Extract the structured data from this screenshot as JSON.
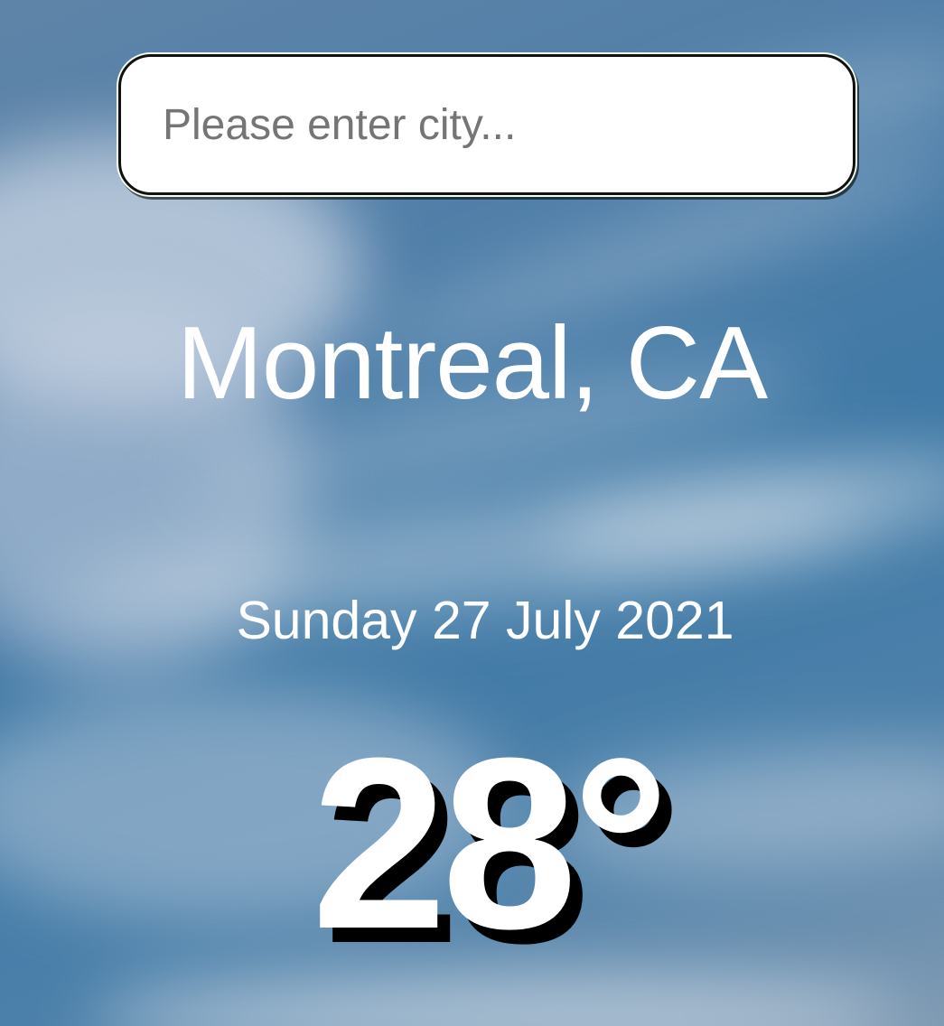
{
  "search": {
    "placeholder": "Please enter city...",
    "value": ""
  },
  "location": {
    "city": "Montreal, CA"
  },
  "date": {
    "text": "Sunday 27 July 2021"
  },
  "weather": {
    "temperature": "28°"
  },
  "colors": {
    "text": "#ffffff",
    "temperature_shadow": "#000000",
    "search_background": "#ffffff",
    "search_border": "#111111",
    "sky": "#3f79a6"
  }
}
